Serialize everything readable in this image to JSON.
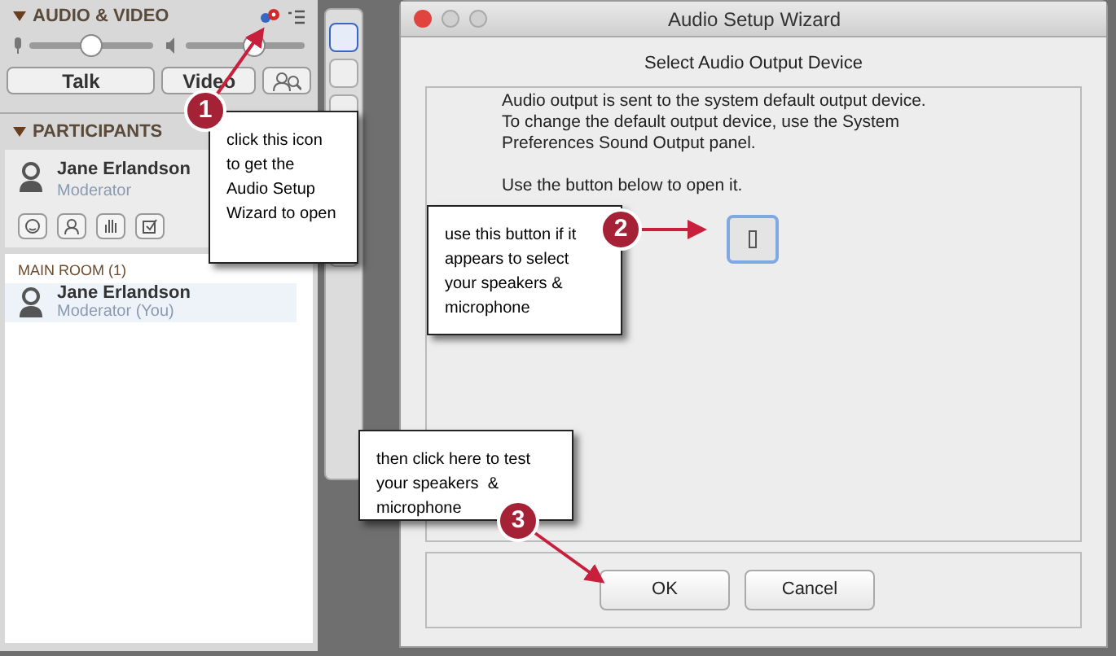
{
  "audio_video": {
    "title": "AUDIO & VIDEO",
    "expanded": true,
    "mic_slider": {
      "level": 0.5
    },
    "speaker_slider": {
      "level": 0.58
    },
    "buttons": [
      "Talk",
      "Video"
    ]
  },
  "participants": {
    "title": "PARTICIPANTS",
    "expanded": true,
    "me": {
      "name": "Jane Erlandson",
      "role": "Moderator"
    },
    "room": {
      "title": "MAIN ROOM (1)",
      "rows": [
        {
          "name": "Jane Erlandson",
          "role": "Moderator (You)",
          "selected": true
        }
      ]
    }
  },
  "dialog": {
    "title": "Audio Setup Wizard",
    "heading": "Select Audio Output Device",
    "paragraphs": [
      "Audio output is sent to the system default output device. To change the default output device, use the System Preferences Sound Output panel.",
      "Use the button below to open it."
    ],
    "buttons": [
      "OK",
      "Cancel"
    ]
  },
  "callouts": [
    {
      "number": "1",
      "text": "click this icon to get the Audio Setup Wizard to open"
    },
    {
      "number": "2",
      "text": "use this button if it appears to select your speakers & microphone"
    },
    {
      "number": "3",
      "text": "then click here to test your speakers  & microphone"
    }
  ]
}
